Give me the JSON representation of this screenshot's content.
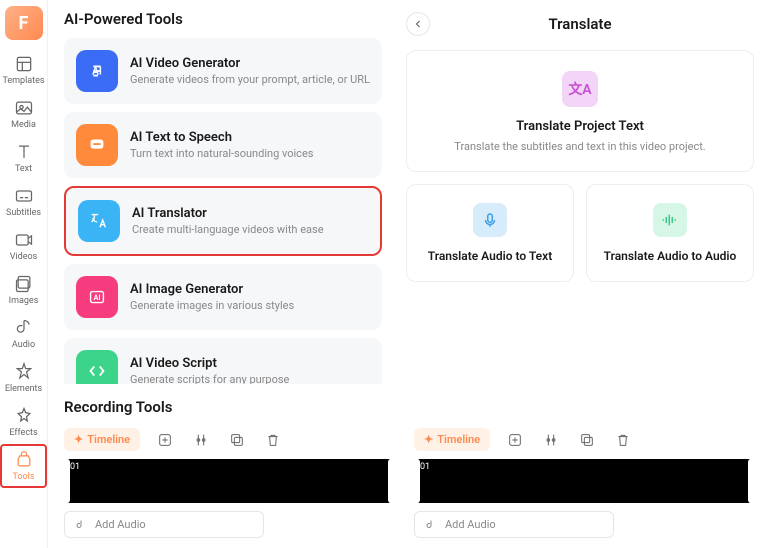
{
  "sidebar": {
    "items": [
      {
        "label": "Templates"
      },
      {
        "label": "Media"
      },
      {
        "label": "Text"
      },
      {
        "label": "Subtitles"
      },
      {
        "label": "Videos"
      },
      {
        "label": "Images"
      },
      {
        "label": "Audio"
      },
      {
        "label": "Elements"
      },
      {
        "label": "Effects"
      },
      {
        "label": "Tools"
      }
    ]
  },
  "left_panel": {
    "section_title": "AI-Powered Tools",
    "tools": [
      {
        "title": "AI Video Generator",
        "desc": "Generate videos from your prompt, article, or URL",
        "color": "#3b6cf6"
      },
      {
        "title": "AI Text to Speech",
        "desc": "Turn text into natural-sounding voices",
        "color": "#ff8a3b"
      },
      {
        "title": "AI Translator",
        "desc": "Create multi-language videos with ease",
        "color": "#3bb4f6",
        "highlight": true
      },
      {
        "title": "AI Image Generator",
        "desc": "Generate images in various styles",
        "color": "#f63b7e"
      },
      {
        "title": "AI Video Script",
        "desc": "Generate scripts for any purpose",
        "color": "#3bd48a"
      }
    ],
    "recording_title": "Recording Tools"
  },
  "right_panel": {
    "title": "Translate",
    "hero": {
      "title": "Translate Project Text",
      "desc": "Translate the subtitles and text in this video project."
    },
    "cards": [
      {
        "label": "Translate Audio to Text"
      },
      {
        "label": "Translate Audio to Audio"
      }
    ]
  },
  "timeline": {
    "pill": "Timeline",
    "add_audio": "Add Audio",
    "track_label": "01"
  }
}
